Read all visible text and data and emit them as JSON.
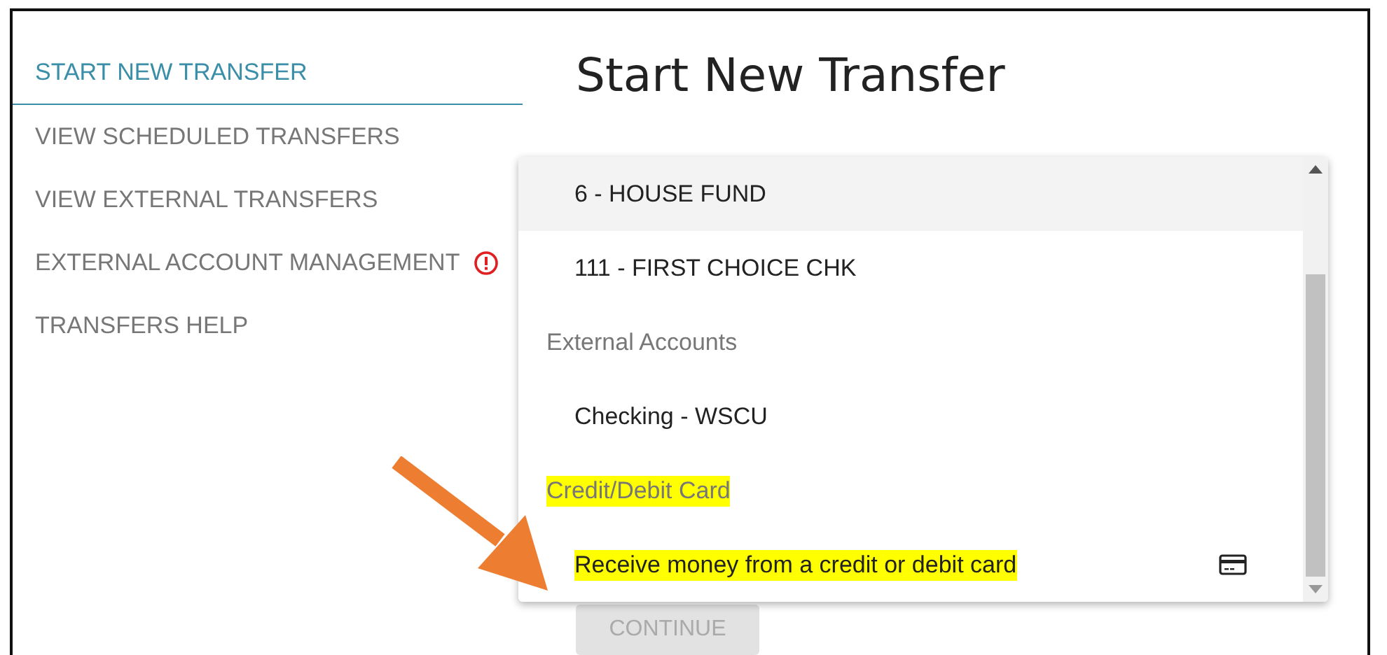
{
  "sidebar": {
    "items": [
      {
        "label": "START NEW TRANSFER",
        "selected": true,
        "alert": false
      },
      {
        "label": "VIEW SCHEDULED TRANSFERS",
        "selected": false,
        "alert": false
      },
      {
        "label": "VIEW EXTERNAL TRANSFERS",
        "selected": false,
        "alert": false
      },
      {
        "label": "EXTERNAL ACCOUNT MANAGEMENT",
        "selected": false,
        "alert": true
      },
      {
        "label": "TRANSFERS HELP",
        "selected": false,
        "alert": false
      }
    ]
  },
  "main": {
    "title": "Start New Transfer",
    "dropdown": {
      "items": [
        {
          "kind": "option",
          "label": "6 - HOUSE FUND",
          "hovered": true,
          "highlighted": false
        },
        {
          "kind": "option",
          "label": "111 - FIRST CHOICE CHK",
          "hovered": false,
          "highlighted": false
        },
        {
          "kind": "group",
          "label": "External Accounts",
          "hovered": false,
          "highlighted": false
        },
        {
          "kind": "option",
          "label": "Checking - WSCU",
          "hovered": false,
          "highlighted": false
        },
        {
          "kind": "group",
          "label": "Credit/Debit Card",
          "hovered": false,
          "highlighted": true
        },
        {
          "kind": "card-option",
          "label": "Receive money from a credit or debit card",
          "hovered": false,
          "highlighted": true
        }
      ]
    },
    "continue_button": {
      "label": "CONTINUE",
      "disabled": true
    }
  }
}
